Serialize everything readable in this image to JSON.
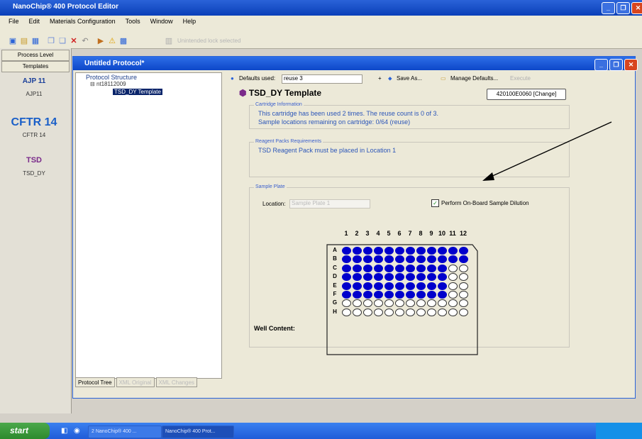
{
  "app": {
    "title": "NanoChip® 400 Protocol Editor"
  },
  "menu": [
    "File",
    "Edit",
    "Materials Configuration",
    "Tools",
    "Window",
    "Help"
  ],
  "toolbar": {
    "readonly_text": "Unintended lock selected"
  },
  "left_panel": {
    "tabs": [
      "Process Level",
      "Templates"
    ],
    "templates": [
      {
        "logo": "AJP 11",
        "label": "AJP11"
      },
      {
        "logo": "CFTR 14",
        "label": "CFTR 14"
      },
      {
        "logo": "TSD",
        "label": "TSD_DY"
      }
    ]
  },
  "inner_window": {
    "title": "Untitled Protocol*"
  },
  "tree": {
    "header": "Protocol Structure",
    "root": "nt18112009",
    "child": "TSD_DY Template",
    "bottom_tabs": [
      "Protocol Tree",
      "XML Original",
      "XML Changes"
    ]
  },
  "detail": {
    "defaults_label": "Defaults used:",
    "defaults_value": "reuse 3",
    "save_as": "Save As...",
    "manage_defaults": "Manage Defaults...",
    "execute": "Execute",
    "title": "TSD_DY Template",
    "change_button": "420100E0060 [Change]",
    "cartridge": {
      "caption": "Cartridge Information",
      "line1": "This cartridge has been used 2 times. The reuse count is 0 of 3.",
      "line2": "Sample locations remaining on cartridge: 0/64 (reuse)"
    },
    "reagent": {
      "caption": "Reagent Packs Requirements",
      "line1": "TSD Reagent Pack must be placed in Location 1"
    },
    "sample_plate": {
      "caption": "Sample Plate",
      "location_label": "Location:",
      "location_value": "Sample Plate 1",
      "dilution_label": "Perform On-Board Sample Dilution",
      "dilution_checked": true,
      "columns": [
        "1",
        "2",
        "3",
        "4",
        "5",
        "6",
        "7",
        "8",
        "9",
        "10",
        "11",
        "12"
      ],
      "rows": [
        "A",
        "B",
        "C",
        "D",
        "E",
        "F",
        "G",
        "H"
      ],
      "filled_per_row": [
        12,
        12,
        10,
        10,
        10,
        10,
        0,
        0
      ],
      "well_content_label": "Well Content:"
    }
  },
  "taskbar": {
    "start": "start",
    "tasks": [
      "2 NanoChip® 400 ...",
      "NanoChip® 400 Prot..."
    ]
  },
  "colors": {
    "well_filled": "#0000cc",
    "title_bar": "#0a3fb8"
  }
}
